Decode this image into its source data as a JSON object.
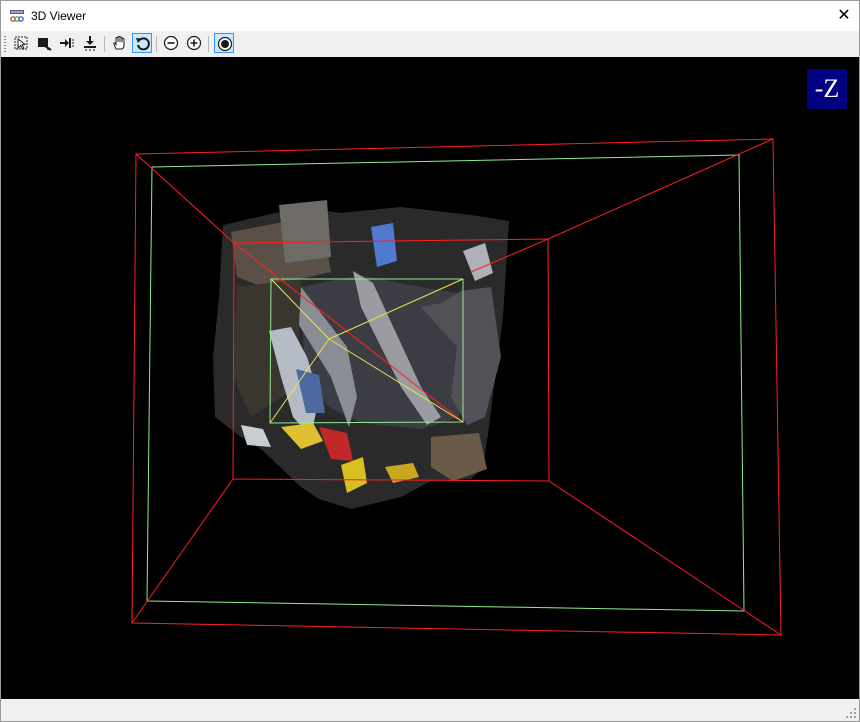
{
  "window": {
    "title": "3D Viewer",
    "close_glyph": "✕",
    "app_icon": "viewer-app-icon"
  },
  "toolbar": {
    "buttons": [
      {
        "name": "select-tool",
        "icon": "select-region-icon",
        "active": false
      },
      {
        "name": "camera-view",
        "icon": "camera-view-icon",
        "active": false
      },
      {
        "name": "fit-x",
        "icon": "fit-arrow-right-icon",
        "active": false
      },
      {
        "name": "fit-y",
        "icon": "fit-arrow-down-icon",
        "active": false
      },
      {
        "name": "pan-tool",
        "icon": "hand-pan-icon",
        "active": false
      },
      {
        "name": "rotate-tool",
        "icon": "rotate-icon",
        "active": true
      },
      {
        "name": "zoom-out",
        "icon": "zoom-out-icon",
        "active": false
      },
      {
        "name": "zoom-in",
        "icon": "zoom-in-icon",
        "active": false
      },
      {
        "name": "record",
        "icon": "record-icon",
        "active": true
      }
    ]
  },
  "viewport": {
    "background": "#000000",
    "axis_label": "-Z",
    "axis_badge_color": "#000080",
    "frustum_color": "#ff2020",
    "inner_frame_color": "#90ee90",
    "center_lines_color": "#e6e64c"
  }
}
